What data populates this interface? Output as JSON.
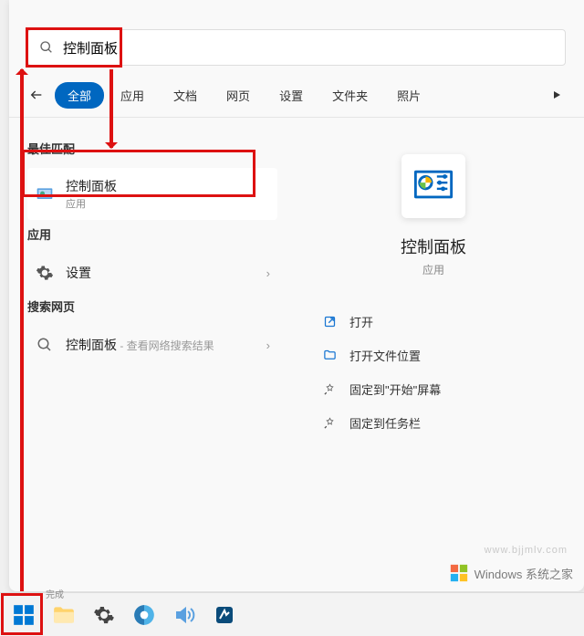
{
  "search": {
    "value": "控制面板",
    "placeholder": ""
  },
  "tabs": {
    "items": [
      "全部",
      "应用",
      "文档",
      "网页",
      "设置",
      "文件夹",
      "照片"
    ],
    "active_index": 0
  },
  "left": {
    "best_match_label": "最佳匹配",
    "best_match": {
      "title": "控制面板",
      "subtitle": "应用"
    },
    "apps_label": "应用",
    "apps_item": {
      "title": "设置"
    },
    "web_label": "搜索网页",
    "web_item": {
      "title": "控制面板",
      "suffix": " - 查看网络搜索结果"
    }
  },
  "right": {
    "title": "控制面板",
    "subtitle": "应用",
    "actions": [
      {
        "icon": "open-external-icon",
        "label": "打开",
        "color": "#1976d2"
      },
      {
        "icon": "folder-icon",
        "label": "打开文件位置",
        "color": "#1976d2"
      },
      {
        "icon": "pin-icon",
        "label": "固定到\"开始\"屏幕",
        "color": "#555"
      },
      {
        "icon": "pin-icon",
        "label": "固定到任务栏",
        "color": "#555"
      }
    ]
  },
  "watermark": {
    "text": "Windows 系统之家",
    "url": "www.bjjmlv.com"
  },
  "done_text": "完成"
}
